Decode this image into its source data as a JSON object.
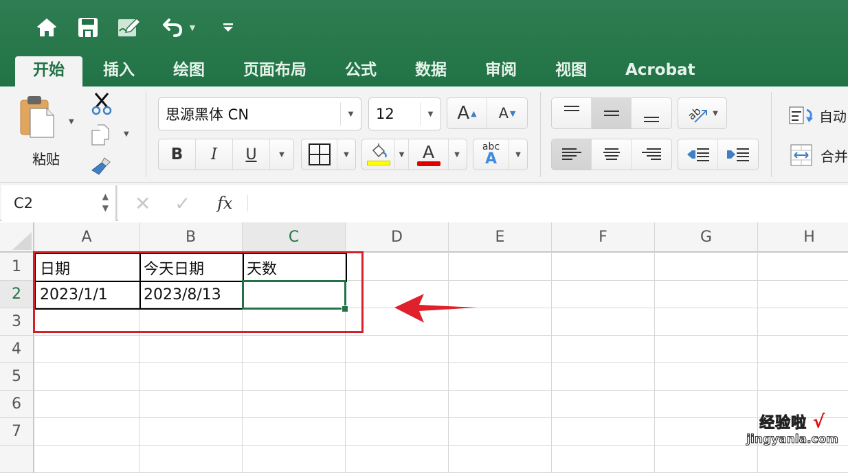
{
  "quick_access": {
    "icons": [
      "home-icon",
      "save-icon",
      "edit-icon",
      "undo-icon",
      "customize-icon"
    ]
  },
  "tabs": [
    {
      "label": "开始",
      "active": true
    },
    {
      "label": "插入",
      "active": false
    },
    {
      "label": "绘图",
      "active": false
    },
    {
      "label": "页面布局",
      "active": false
    },
    {
      "label": "公式",
      "active": false
    },
    {
      "label": "数据",
      "active": false
    },
    {
      "label": "审阅",
      "active": false
    },
    {
      "label": "视图",
      "active": false
    },
    {
      "label": "Acrobat",
      "active": false
    }
  ],
  "ribbon": {
    "paste_label": "粘贴",
    "font_name": "思源黑体 CN",
    "font_size": "12",
    "bold": "B",
    "italic": "I",
    "underline": "U",
    "font_color_glyph": "A",
    "grow_glyph": "A",
    "shrink_glyph": "A",
    "phonetic_top": "abc",
    "phonetic_bottom": "A",
    "wrap_text_label": "自动",
    "merge_label": "合并",
    "fill_color": "#ffff00",
    "font_color": "#e00000"
  },
  "formula_bar": {
    "name_box": "C2",
    "fx_label": "fx",
    "formula": ""
  },
  "sheet": {
    "columns": [
      "A",
      "B",
      "C",
      "D",
      "E",
      "F",
      "G",
      "H"
    ],
    "selected_column": "C",
    "rows": [
      "1",
      "2",
      "3",
      "4",
      "5",
      "6",
      "7"
    ],
    "selected_row": "2",
    "cells": {
      "A1": "日期",
      "B1": "今天日期",
      "C1": "天数",
      "A2": "2023/1/1",
      "B2": "2023/8/13",
      "C2": ""
    },
    "selected_cell": "C2"
  },
  "annotation": {
    "color": "#d4202a"
  },
  "watermark": {
    "line1": "经验啦",
    "check": "√",
    "line2": "jingyanla.com"
  }
}
